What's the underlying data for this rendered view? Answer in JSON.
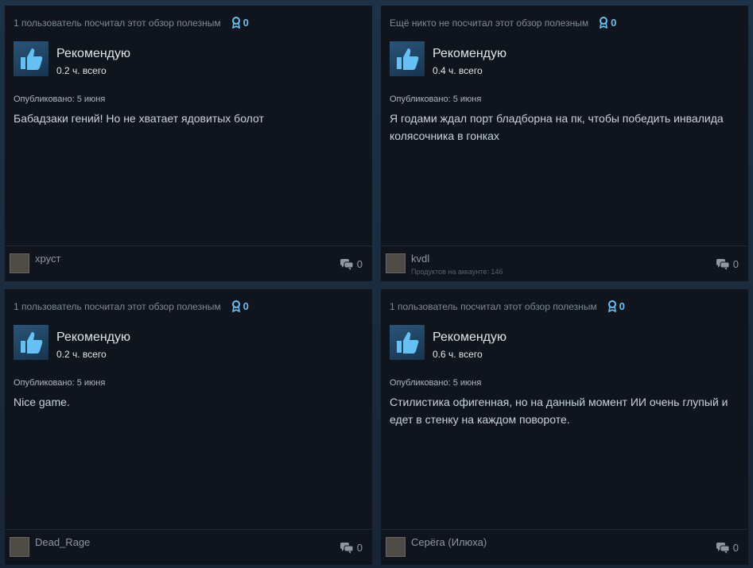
{
  "reviews": [
    {
      "helpful_text": "1 пользователь посчитал этот обзор полезным",
      "awards_count": "0",
      "verdict": "Рекомендую",
      "hours": "0.2 ч. всего",
      "posted": "Опубликовано: 5 июня",
      "text": "Бабадзаки гений! Но не хватает ядовитых болот",
      "author": "хруст",
      "products": "",
      "comments": "0"
    },
    {
      "helpful_text": "Ещё никто не посчитал этот обзор полезным",
      "awards_count": "0",
      "verdict": "Рекомендую",
      "hours": "0.4 ч. всего",
      "posted": "Опубликовано: 5 июня",
      "text": "Я годами ждал порт бладборна на пк, чтобы победить инвалида колясочника в гонках",
      "author": "kvdl",
      "products": "Продуктов на аккаунте: 146",
      "comments": "0"
    },
    {
      "helpful_text": "1 пользователь посчитал этот обзор полезным",
      "awards_count": "0",
      "verdict": "Рекомендую",
      "hours": "0.2 ч. всего",
      "posted": "Опубликовано: 5 июня",
      "text": "Nice game.",
      "author": "Dead_Rage",
      "products": "",
      "comments": "0"
    },
    {
      "helpful_text": "1 пользователь посчитал этот обзор полезным",
      "awards_count": "0",
      "verdict": "Рекомендую",
      "hours": "0.6 ч. всего",
      "posted": "Опубликовано: 5 июня",
      "text": "Стилистика офигенная, но на данный момент ИИ очень глупый и едет в стенку на каждом повороте.",
      "author": "Серёга (Илюха)",
      "products": "",
      "comments": "0"
    }
  ],
  "colors": {
    "accent": "#66c0f4",
    "card_bg": "#0f141d",
    "page_bg": "#1b2838"
  },
  "icons": {
    "award": "award-ribbon-icon",
    "recommend": "thumbs-up-icon",
    "comments": "speech-bubbles-icon"
  }
}
